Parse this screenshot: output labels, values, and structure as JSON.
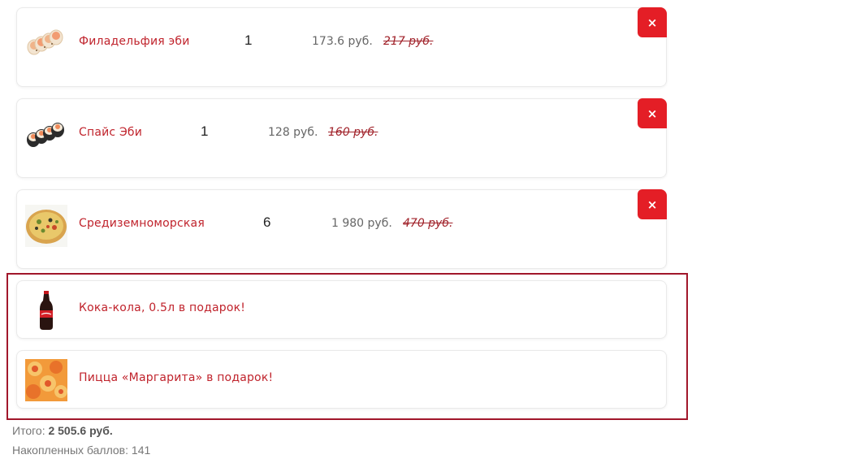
{
  "colors": {
    "accent": "#e41e26",
    "name_text": "#c0232c",
    "gift_border": "#a1172b"
  },
  "cart": {
    "items": [
      {
        "name": "Филадельфия эби",
        "quantity": "1",
        "price": "173.6 руб.",
        "old_price": "217 руб.",
        "remove_label": "×",
        "thumb_icon": "sushi-roll-philadelphia-icon"
      },
      {
        "name": "Спайс Эби",
        "quantity": "1",
        "price": "128 руб.",
        "old_price": "160 руб.",
        "remove_label": "×",
        "thumb_icon": "sushi-roll-spice-icon"
      },
      {
        "name": "Средиземноморская",
        "quantity": "6",
        "price": "1 980 руб.",
        "old_price": "470 руб.",
        "remove_label": "×",
        "thumb_icon": "pizza-icon"
      }
    ],
    "gifts": [
      {
        "name": "Кока-кола, 0.5л в подарок!",
        "thumb_icon": "cola-bottle-icon"
      },
      {
        "name": "Пицца «Маргарита» в подарок!",
        "thumb_icon": "pizza-margherita-icon"
      }
    ]
  },
  "summary": {
    "total_label": "Итого:",
    "total_value": "2 505.6 руб.",
    "points_label": "Накопленных баллов:",
    "points_value": "141"
  }
}
